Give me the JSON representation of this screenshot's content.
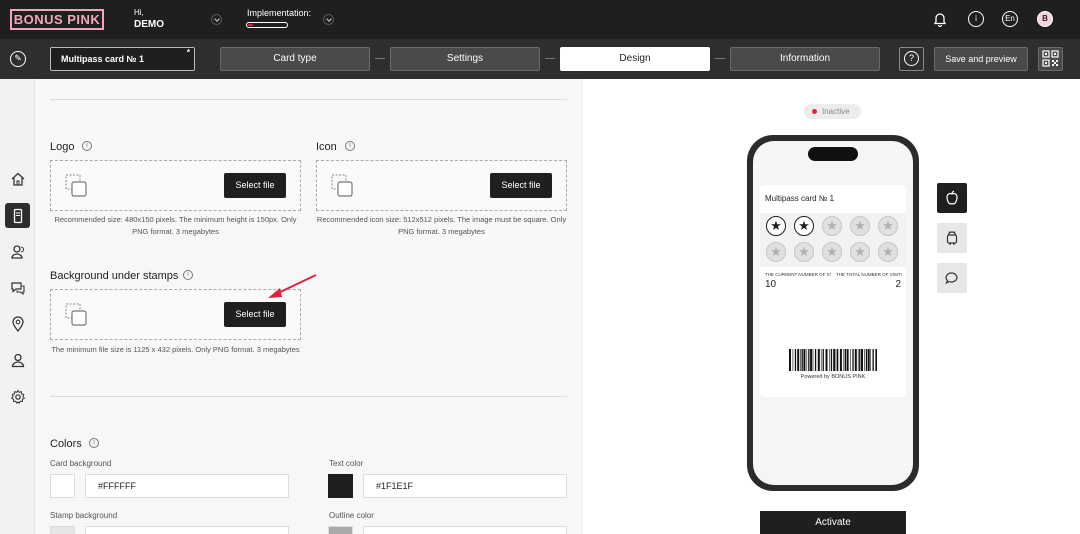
{
  "header": {
    "logo": "BONUS PINK",
    "greeting": "Hi,",
    "user": "DEMO",
    "implementation_label": "Implementation:",
    "implementation_progress": 0.12,
    "language": "En",
    "avatar_letter": "B"
  },
  "toolbar": {
    "card_name": "Multipass card № 1",
    "card_name_marker": "*",
    "steps": [
      {
        "label": "Card type"
      },
      {
        "label": "Settings"
      },
      {
        "label": "Design"
      },
      {
        "label": "Information"
      }
    ],
    "active_step": "Design",
    "help": "?",
    "save_label": "Save and preview"
  },
  "editor": {
    "logo": {
      "label": "Logo",
      "button": "Select file",
      "hint": "Recommended size: 480x150 pixels. The minimum height is 150px. Only PNG format. 3 megabytes"
    },
    "icon": {
      "label": "Icon",
      "button": "Select file",
      "hint": "Recommended icon size: 512x512 pixels. The image must be square. Only PNG format. 3 megabytes"
    },
    "background": {
      "label": "Background under stamps",
      "button": "Select file",
      "hint": "The minimum file size is 1125 x 432 pixels. Only PNG format. 3 megabytes"
    },
    "colors": {
      "label": "Colors",
      "card_background_label": "Card background",
      "card_background_value": "#FFFFFF",
      "text_color_label": "Text color",
      "text_color_value": "#1F1E1F",
      "stamp_background_label": "Stamp background",
      "outline_color_label": "Outline color"
    }
  },
  "preview": {
    "status": "Inactive",
    "pass_title": "Multipass card № 1",
    "stamps_filled": 2,
    "stamps_total": 10,
    "field_1_label": "THE CURRENT NUMBER OF STAMPS",
    "field_1_value": "10",
    "field_2_label": "THE TOTAL NUMBER OF VISITS",
    "field_2_value": "2",
    "powered": "Powered by BONUS PINK",
    "activate_label": "Activate"
  },
  "colors": {
    "accent": "#e0223c",
    "brand_pink": "#f3a6b8",
    "dark": "#1f1f1f"
  }
}
